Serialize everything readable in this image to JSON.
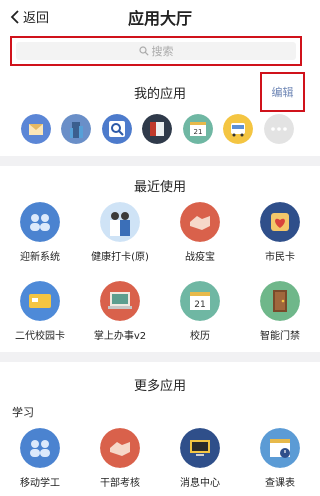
{
  "header": {
    "back_label": "返回",
    "title": "应用大厅"
  },
  "search": {
    "placeholder": "搜索"
  },
  "mine": {
    "title": "我的应用",
    "edit_label": "编辑",
    "icons": [
      "envelope-icon",
      "building-icon",
      "magnifier-icon",
      "book-icon",
      "calendar-icon",
      "bus-icon",
      "more-icon"
    ]
  },
  "recent": {
    "title": "最近使用",
    "apps": [
      {
        "label": "迎新系统",
        "icon": "people-icon"
      },
      {
        "label": "健康打卡(原)",
        "icon": "doctors-icon"
      },
      {
        "label": "战疫宝",
        "icon": "handshake-icon"
      },
      {
        "label": "市民卡",
        "icon": "heart-card-icon"
      },
      {
        "label": "二代校园卡",
        "icon": "campus-card-icon"
      },
      {
        "label": "掌上办事v2",
        "icon": "laptop-icon"
      },
      {
        "label": "校历",
        "icon": "calendar-icon"
      },
      {
        "label": "智能门禁",
        "icon": "door-icon"
      }
    ]
  },
  "more": {
    "title": "更多应用",
    "category": "学习",
    "apps": [
      {
        "label": "移动学工",
        "icon": "people-icon"
      },
      {
        "label": "干部考核",
        "icon": "handshake-icon"
      },
      {
        "label": "消息中心",
        "icon": "monitor-icon"
      },
      {
        "label": "查课表",
        "icon": "schedule-icon"
      }
    ]
  },
  "colors": {
    "accent_red": "#d0121b",
    "link_blue": "#6e86b5"
  }
}
